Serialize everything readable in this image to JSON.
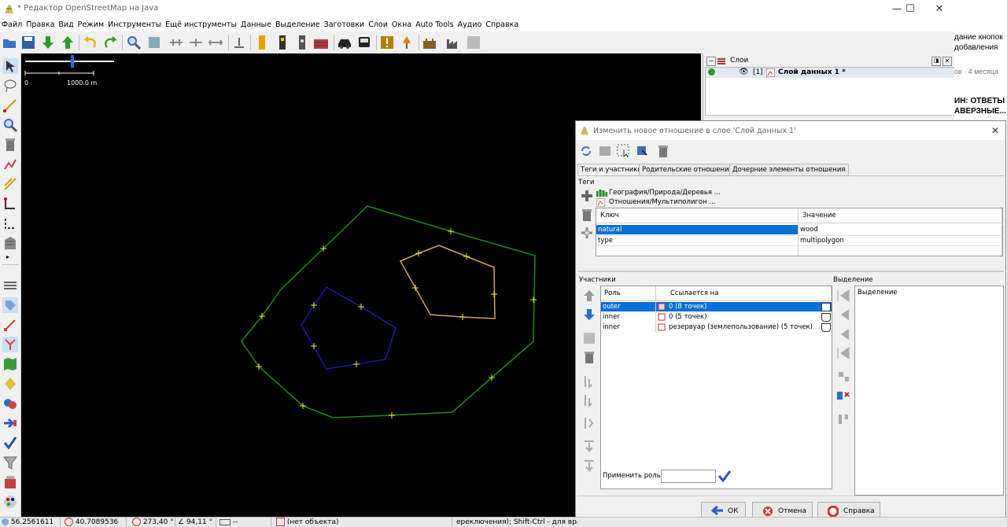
{
  "window": {
    "title": "* Редактор OpenStreetMap на Java",
    "min": "—",
    "max": "☐",
    "close": "✕"
  },
  "menu": [
    "Файл",
    "Правка",
    "Вид",
    "Режим",
    "Инструменты",
    "Ещё инструменты",
    "Данные",
    "Выделение",
    "Заготовки",
    "Слои",
    "Окна",
    "Auto Tools",
    "Аудио",
    "Справка"
  ],
  "scale": {
    "zero": "0",
    "distance": "1000.0 m"
  },
  "layers": {
    "title": "Слои",
    "index": "[1]",
    "name": "Слой данных 1 *"
  },
  "browser": {
    "l1": "дание кнопок",
    "l2": "добавления",
    "l3": "ов · 4 месяца",
    "l4": "ИН: ОТВЕТЫ",
    "l5": "АВЕРЗНЫЕ..."
  },
  "dialog": {
    "title": "Изменить новое отношение в слое 'Слой данных 1'",
    "tabs": [
      "Теги и участники",
      "Родительские отношения",
      "Дочерние элементы отношения"
    ],
    "tags_label": "Теги",
    "presets": [
      "География/Природа/Деревья ...",
      "Отношения/Мультиполигон ..."
    ],
    "tag_columns": {
      "key": "Ключ",
      "value": "Значение"
    },
    "tags": [
      {
        "key": "natural",
        "value": "wood"
      },
      {
        "key": "type",
        "value": "multipolygon"
      }
    ],
    "members_label": "Участники",
    "member_columns": {
      "role": "Роль",
      "ref": "Ссылается на"
    },
    "members": [
      {
        "role": "outer",
        "ref": "0 (8 точек)"
      },
      {
        "role": "inner",
        "ref": "0 (5 точек)"
      },
      {
        "role": "inner",
        "ref": "резервуар (землепользование) (5 точек)"
      }
    ],
    "selection_label": "Выделение",
    "selection_column": "Выделение",
    "apply_role": "Применить роль:",
    "ok": "ОК",
    "cancel": "Отмена",
    "help": "Справка"
  },
  "status": {
    "lat": "56.2561611",
    "lon": "40.7089536",
    "heading": "273,40 °",
    "angle": "94,11 °",
    "length": "--",
    "object": "(нет объекта)",
    "hint": "ереключения); Shift-Ctrl - для вращения"
  },
  "colors": {
    "outer": "#1e8a1e",
    "inner_blue": "#1a1aaa",
    "inner_tan": "#d2a060",
    "node": "#e8f020",
    "selected": "#0a6fd6"
  }
}
